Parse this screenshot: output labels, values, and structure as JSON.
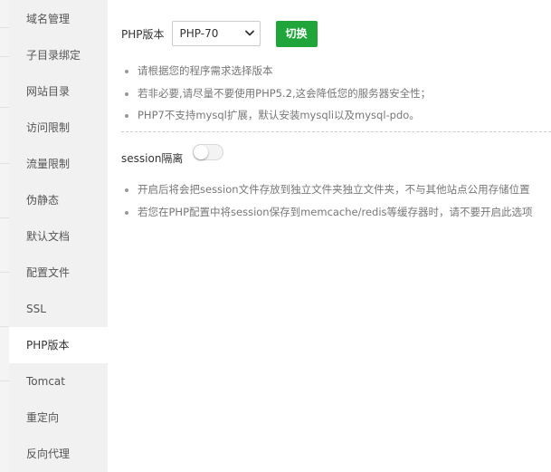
{
  "sidebar": {
    "items": [
      {
        "label": "域名管理"
      },
      {
        "label": "子目录绑定"
      },
      {
        "label": "网站目录"
      },
      {
        "label": "访问限制"
      },
      {
        "label": "流量限制"
      },
      {
        "label": "伪静态"
      },
      {
        "label": "默认文档"
      },
      {
        "label": "配置文件"
      },
      {
        "label": "SSL"
      },
      {
        "label": "PHP版本",
        "active": true
      },
      {
        "label": "Tomcat"
      },
      {
        "label": "重定向"
      },
      {
        "label": "反向代理"
      }
    ]
  },
  "php": {
    "label": "PHP版本",
    "selected_version": "PHP-70",
    "switch_label": "切换",
    "tips": [
      "请根据您的程序需求选择版本",
      "若非必要,请尽量不要使用PHP5.2,这会降低您的服务器安全性；",
      "PHP7不支持mysql扩展，默认安装mysqli以及mysql-pdo。"
    ]
  },
  "session": {
    "label": "session隔离",
    "enabled": false,
    "tips": [
      "开启后将会把session文件存放到独立文件夹独立文件夹，不与其他站点公用存储位置",
      "若您在PHP配置中将session保存到memcache/redis等缓存器时，请不要开启此选项"
    ]
  },
  "colors": {
    "accent": "#20a53a",
    "sidebar_bg": "#f1f1f1",
    "tip_text": "#777777"
  },
  "icons": {
    "select_arrow": "chevron-down-icon"
  }
}
